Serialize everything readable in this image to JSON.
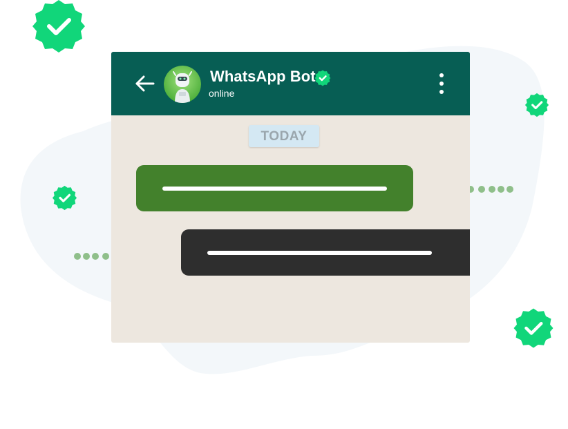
{
  "chat": {
    "contact_name": "WhatsApp Bot",
    "status": "online",
    "date_divider": "TODAY"
  },
  "colors": {
    "header": "#075e54",
    "chat_background": "#ede7df",
    "outgoing_bubble": "#43812c",
    "incoming_bubble": "#2e2e2e",
    "verified_badge": "#11d67a",
    "date_chip": "#d4e8f3",
    "dot_trail": "#8fbf8a",
    "background_blob": "#f3f7fa"
  },
  "icons": {
    "back": "arrow-left-icon",
    "menu": "vertical-dots-icon",
    "verified": "verified-check-badge-icon",
    "avatar": "robot-avatar-icon"
  }
}
